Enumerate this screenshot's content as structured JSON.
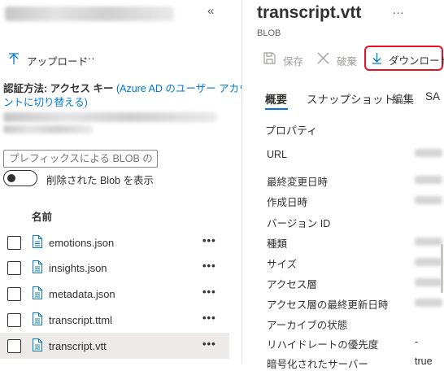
{
  "left_pane": {
    "collapse_glyph": "«",
    "toolbar": {
      "upload_label": "アップロード",
      "more_label": "…"
    },
    "auth": {
      "prefix": "認証方法: アクセス キー ",
      "link_line1": "(Azure AD のユーザー アカウ",
      "link_line2": "ントに切り替える)"
    },
    "search": {
      "placeholder": "プレフィックスによる BLOB の検..."
    },
    "toggle": {
      "label": "削除された Blob を表示",
      "on": false
    },
    "table": {
      "column_header": "名前",
      "rows": [
        {
          "name": "emotions.json",
          "more": "•••",
          "selected": false
        },
        {
          "name": "insights.json",
          "more": "•••",
          "selected": false
        },
        {
          "name": "metadata.json",
          "more": "•••",
          "selected": false
        },
        {
          "name": "transcript.ttml",
          "more": "•••",
          "selected": false
        },
        {
          "name": "transcript.vtt",
          "more": "•••",
          "selected": true
        }
      ]
    }
  },
  "right_pane": {
    "title": "transcript.vtt",
    "title_more": "…",
    "subtitle": "BLOB",
    "commands": {
      "save_label": "保存",
      "discard_label": "破棄",
      "download_label": "ダウンロード"
    },
    "tabs": [
      {
        "label": "概要",
        "active": true
      },
      {
        "label": "スナップショット",
        "active": false
      },
      {
        "label": "編集",
        "active": false
      },
      {
        "label": "SA",
        "active": false
      }
    ],
    "section_title": "プロパティ",
    "properties": [
      {
        "label": "URL",
        "value": ""
      },
      {
        "label": "最終変更日時",
        "value": ""
      },
      {
        "label": "作成日時",
        "value": ""
      },
      {
        "label": "バージョン ID",
        "value": ""
      },
      {
        "label": "種類",
        "value": ""
      },
      {
        "label": "サイズ",
        "value": ""
      },
      {
        "label": "アクセス層",
        "value": ""
      },
      {
        "label": "アクセス層の最終更新日時",
        "value": ""
      },
      {
        "label": "アーカイブの状態",
        "value": ""
      },
      {
        "label": "リハイドレートの優先度",
        "value": "-"
      },
      {
        "label": "暗号化されたサーバー",
        "value": "true"
      }
    ]
  },
  "colors": {
    "accent": "#0078d4",
    "highlight_border": "#e81123",
    "selected_row": "#edebe9",
    "text": "#323130",
    "muted": "#605e5c"
  }
}
